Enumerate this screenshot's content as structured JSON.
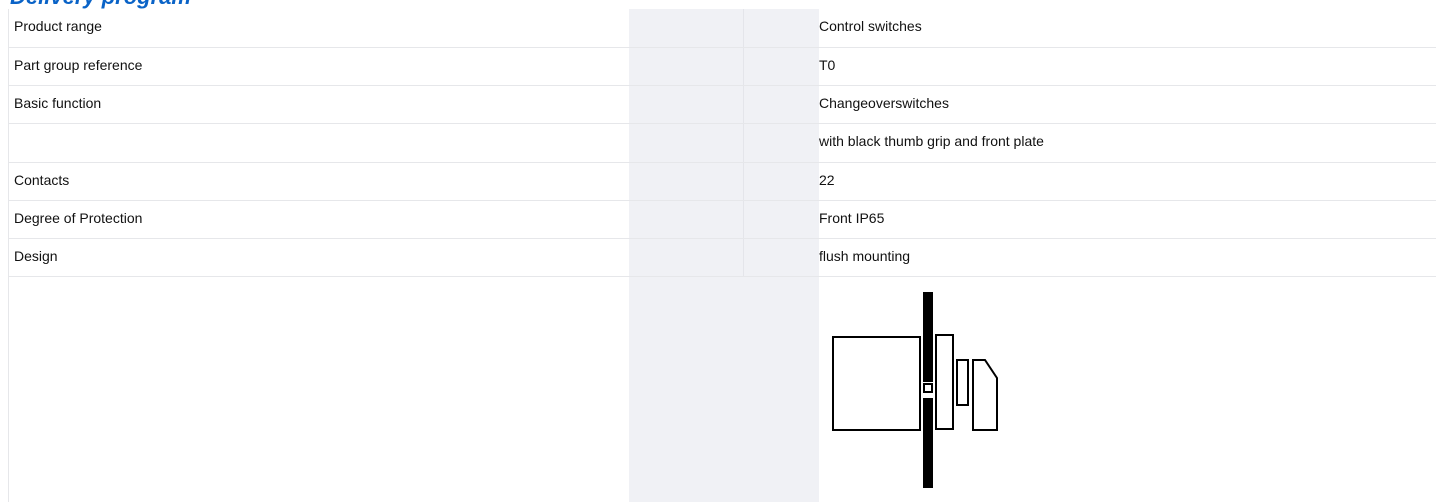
{
  "section": {
    "heading": "Delivery program"
  },
  "rows": [
    {
      "label": "Product range",
      "value": "Control switches"
    },
    {
      "label": "Part group reference",
      "value": "T0"
    },
    {
      "label": "Basic function",
      "value": "Changeoverswitches"
    },
    {
      "label": "",
      "value": "with black thumb grip and front plate"
    },
    {
      "label": "Contacts",
      "value": "22"
    },
    {
      "label": "Degree of Protection",
      "value": "Front IP65"
    },
    {
      "label": "Design",
      "value": "flush mounting"
    },
    {
      "label": "",
      "value": ""
    }
  ],
  "illustration": {
    "icon": "flush-mounting-diagram-icon"
  },
  "colors": {
    "heading": "#0a63c7",
    "row_divider": "#e6e7ea",
    "shaded_column": "#f0f1f5"
  }
}
